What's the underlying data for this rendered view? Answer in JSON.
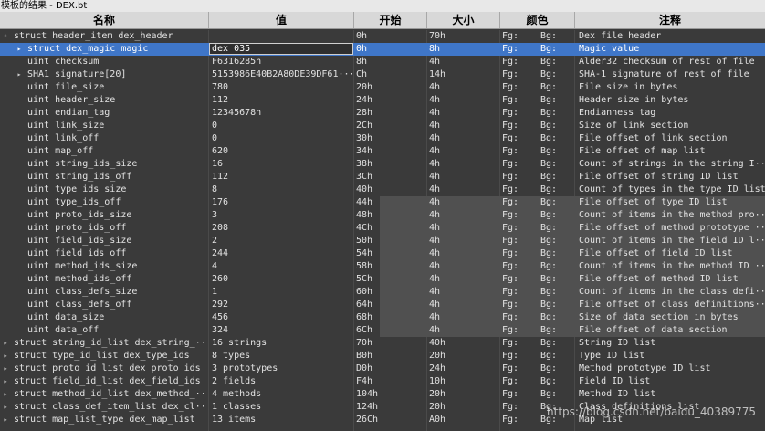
{
  "window": {
    "title": "模板的结果 - DEX.bt"
  },
  "columns": [
    {
      "key": "name",
      "label": "名称"
    },
    {
      "key": "value",
      "label": "值"
    },
    {
      "key": "start",
      "label": "开始"
    },
    {
      "key": "size",
      "label": "大小"
    },
    {
      "key": "color",
      "label": "颜色"
    },
    {
      "key": "comment",
      "label": "注释"
    }
  ],
  "rows": [
    {
      "expander": "minus",
      "level": 0,
      "name": "struct header_item dex_header",
      "value": "",
      "start": "0h",
      "size": "70h",
      "fg": "Fg:",
      "bg": "Bg:",
      "comment": "Dex file header"
    },
    {
      "expander": "plus",
      "level": 1,
      "selected": true,
      "name": "struct dex_magic magic",
      "value": "dex 035",
      "start": "0h",
      "size": "8h",
      "fg": "Fg:",
      "bg": "Bg:",
      "comment": "Magic value"
    },
    {
      "level": 1,
      "name": "uint checksum",
      "value": "F6316285h",
      "start": "8h",
      "size": "4h",
      "fg": "Fg:",
      "bg": "Bg:",
      "comment": "Alder32 checksum of rest of file"
    },
    {
      "expander": "plus",
      "level": 1,
      "name": "SHA1 signature[20]",
      "value": "5153986E40B2A80DE39DF61···",
      "start": "Ch",
      "size": "14h",
      "fg": "Fg:",
      "bg": "Bg:",
      "comment": "SHA-1 signature of rest of file"
    },
    {
      "level": 1,
      "name": "uint file_size",
      "value": "780",
      "start": "20h",
      "size": "4h",
      "fg": "Fg:",
      "bg": "Bg:",
      "comment": "File size in bytes"
    },
    {
      "level": 1,
      "name": "uint header_size",
      "value": "112",
      "start": "24h",
      "size": "4h",
      "fg": "Fg:",
      "bg": "Bg:",
      "comment": "Header size in bytes"
    },
    {
      "level": 1,
      "name": "uint endian_tag",
      "value": "12345678h",
      "start": "28h",
      "size": "4h",
      "fg": "Fg:",
      "bg": "Bg:",
      "comment": "Endianness tag"
    },
    {
      "level": 1,
      "name": "uint link_size",
      "value": "0",
      "start": "2Ch",
      "size": "4h",
      "fg": "Fg:",
      "bg": "Bg:",
      "comment": "Size of link section"
    },
    {
      "level": 1,
      "name": "uint link_off",
      "value": "0",
      "start": "30h",
      "size": "4h",
      "fg": "Fg:",
      "bg": "Bg:",
      "comment": "File offset of link section"
    },
    {
      "level": 1,
      "name": "uint map_off",
      "value": "620",
      "start": "34h",
      "size": "4h",
      "fg": "Fg:",
      "bg": "Bg:",
      "comment": "File offset of map list"
    },
    {
      "level": 1,
      "name": "uint string_ids_size",
      "value": "16",
      "start": "38h",
      "size": "4h",
      "fg": "Fg:",
      "bg": "Bg:",
      "comment": "Count of strings in the string I···"
    },
    {
      "level": 1,
      "name": "uint string_ids_off",
      "value": "112",
      "start": "3Ch",
      "size": "4h",
      "fg": "Fg:",
      "bg": "Bg:",
      "comment": "File offset of string ID list"
    },
    {
      "level": 1,
      "name": "uint type_ids_size",
      "value": "8",
      "start": "40h",
      "size": "4h",
      "fg": "Fg:",
      "bg": "Bg:",
      "comment": "Count of types in the type ID list"
    },
    {
      "level": 1,
      "hl": true,
      "name": "uint type_ids_off",
      "value": "176",
      "start": "44h",
      "size": "4h",
      "fg": "Fg:",
      "bg": "Bg:",
      "comment": "File offset of type ID list"
    },
    {
      "level": 1,
      "hl": true,
      "name": "uint proto_ids_size",
      "value": "3",
      "start": "48h",
      "size": "4h",
      "fg": "Fg:",
      "bg": "Bg:",
      "comment": "Count of items in the method pro···"
    },
    {
      "level": 1,
      "hl": true,
      "name": "uint proto_ids_off",
      "value": "208",
      "start": "4Ch",
      "size": "4h",
      "fg": "Fg:",
      "bg": "Bg:",
      "comment": "File offset of method prototype ···"
    },
    {
      "level": 1,
      "hl": true,
      "name": "uint field_ids_size",
      "value": "2",
      "start": "50h",
      "size": "4h",
      "fg": "Fg:",
      "bg": "Bg:",
      "comment": "Count of items in the field ID l···"
    },
    {
      "level": 1,
      "hl": true,
      "name": "uint field_ids_off",
      "value": "244",
      "start": "54h",
      "size": "4h",
      "fg": "Fg:",
      "bg": "Bg:",
      "comment": "File offset of field ID list"
    },
    {
      "level": 1,
      "hl": true,
      "name": "uint method_ids_size",
      "value": "4",
      "start": "58h",
      "size": "4h",
      "fg": "Fg:",
      "bg": "Bg:",
      "comment": "Count of items in the method ID ···"
    },
    {
      "level": 1,
      "hl": true,
      "name": "uint method_ids_off",
      "value": "260",
      "start": "5Ch",
      "size": "4h",
      "fg": "Fg:",
      "bg": "Bg:",
      "comment": "File offset of method ID list"
    },
    {
      "level": 1,
      "hl": true,
      "name": "uint class_defs_size",
      "value": "1",
      "start": "60h",
      "size": "4h",
      "fg": "Fg:",
      "bg": "Bg:",
      "comment": "Count of items in the class defi···"
    },
    {
      "level": 1,
      "hl": true,
      "name": "uint class_defs_off",
      "value": "292",
      "start": "64h",
      "size": "4h",
      "fg": "Fg:",
      "bg": "Bg:",
      "comment": "File offset of class definitions···"
    },
    {
      "level": 1,
      "hl": true,
      "name": "uint data_size",
      "value": "456",
      "start": "68h",
      "size": "4h",
      "fg": "Fg:",
      "bg": "Bg:",
      "comment": "Size of data section in bytes"
    },
    {
      "level": 1,
      "hl": true,
      "name": "uint data_off",
      "value": "324",
      "start": "6Ch",
      "size": "4h",
      "fg": "Fg:",
      "bg": "Bg:",
      "comment": "File offset of data section"
    },
    {
      "expander": "plus",
      "level": 0,
      "name": "struct string_id_list dex_string_···",
      "value": "16 strings",
      "start": "70h",
      "size": "40h",
      "fg": "Fg:",
      "bg": "Bg:",
      "comment": "String ID list"
    },
    {
      "expander": "plus",
      "level": 0,
      "name": "struct type_id_list dex_type_ids",
      "value": "8 types",
      "start": "B0h",
      "size": "20h",
      "fg": "Fg:",
      "bg": "Bg:",
      "comment": "Type ID list"
    },
    {
      "expander": "plus",
      "level": 0,
      "name": "struct proto_id_list dex_proto_ids",
      "value": "3 prototypes",
      "start": "D0h",
      "size": "24h",
      "fg": "Fg:",
      "bg": "Bg:",
      "comment": "Method prototype ID list"
    },
    {
      "expander": "plus",
      "level": 0,
      "name": "struct field_id_list dex_field_ids",
      "value": "2 fields",
      "start": "F4h",
      "size": "10h",
      "fg": "Fg:",
      "bg": "Bg:",
      "comment": "Field ID list"
    },
    {
      "expander": "plus",
      "level": 0,
      "name": "struct method_id_list dex_method_···",
      "value": "4 methods",
      "start": "104h",
      "size": "20h",
      "fg": "Fg:",
      "bg": "Bg:",
      "comment": "Method ID list"
    },
    {
      "expander": "plus",
      "level": 0,
      "name": "struct class_def_item_list dex_cl···",
      "value": "1 classes",
      "start": "124h",
      "size": "20h",
      "fg": "Fg:",
      "bg": "Bg:",
      "comment": "Class definitions list"
    },
    {
      "expander": "plus",
      "level": 0,
      "name": "struct map_list_type dex_map_list",
      "value": "13 items",
      "start": "26Ch",
      "size": "A0h",
      "fg": "Fg:",
      "bg": "Bg:",
      "comment": "Map list"
    }
  ],
  "watermark": "https://blog.csdn.net/baidu_40389775"
}
